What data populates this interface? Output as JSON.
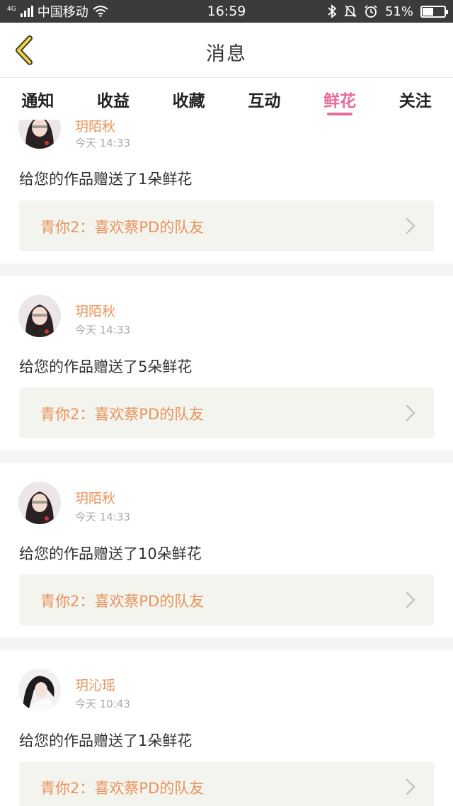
{
  "status_bar": {
    "network": "4G",
    "carrier": "中国移动",
    "time": "16:59",
    "battery_percent": "51%",
    "battery_level": 0.51
  },
  "header": {
    "title": "消息"
  },
  "tabs": [
    {
      "label": "通知",
      "active": false
    },
    {
      "label": "收益",
      "active": false
    },
    {
      "label": "收藏",
      "active": false
    },
    {
      "label": "互动",
      "active": false
    },
    {
      "label": "鲜花",
      "active": true
    },
    {
      "label": "关注",
      "active": false
    }
  ],
  "messages": [
    {
      "sender": "玥陌秋",
      "time": "今天 14:33",
      "text": "给您的作品赠送了1朵鲜花",
      "work": "青你2：喜欢蔡PD的队友"
    },
    {
      "sender": "玥陌秋",
      "time": "今天 14:33",
      "text": "给您的作品赠送了5朵鲜花",
      "work": "青你2：喜欢蔡PD的队友"
    },
    {
      "sender": "玥陌秋",
      "time": "今天 14:33",
      "text": "给您的作品赠送了10朵鲜花",
      "work": "青你2：喜欢蔡PD的队友"
    },
    {
      "sender": "玥沁瑶",
      "time": "今天 10:43",
      "text": "给您的作品赠送了1朵鲜花",
      "work": "青你2：喜欢蔡PD的队友"
    }
  ],
  "colors": {
    "accent_pink": "#e96a9c",
    "sender_orange": "#e8935a",
    "back_yellow": "#f5d23a"
  }
}
